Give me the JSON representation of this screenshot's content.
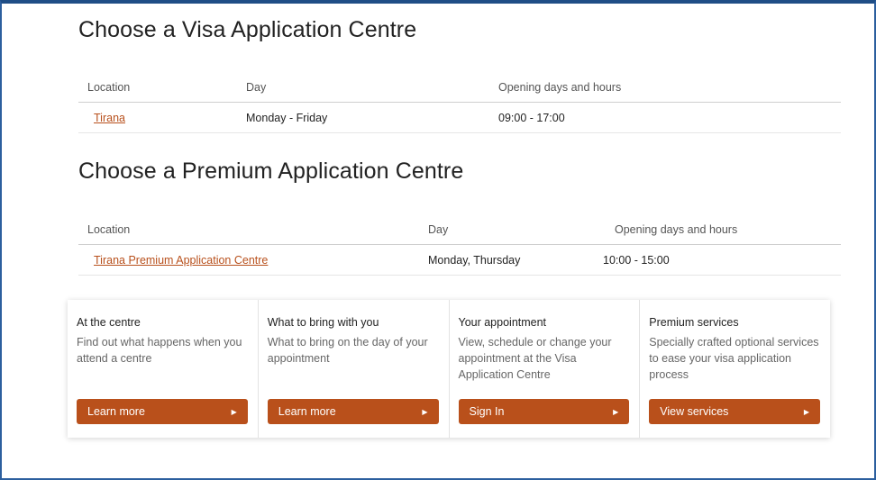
{
  "visa_section": {
    "title": "Choose a Visa Application Centre",
    "headers": [
      "Location",
      "Day",
      "Opening days and hours"
    ],
    "rows": [
      {
        "location": "Tirana",
        "day": "Monday - Friday",
        "hours": "09:00 - 17:00"
      }
    ]
  },
  "premium_section": {
    "title": "Choose a Premium Application Centre",
    "headers": [
      "Location",
      "Day",
      "Opening days and hours"
    ],
    "rows": [
      {
        "location": "Tirana Premium Application Centre",
        "day": "Monday, Thursday",
        "hours": "10:00 - 15:00"
      }
    ]
  },
  "cards": [
    {
      "title": "At the centre",
      "description": "Find out what happens when you attend a centre",
      "button": "Learn more"
    },
    {
      "title": "What to bring with you",
      "description": "What to bring on the day of your appointment",
      "button": "Learn more"
    },
    {
      "title": "Your appointment",
      "description": "View, schedule or change your appointment at the Visa Application Centre",
      "button": "Sign In"
    },
    {
      "title": "Premium services",
      "description": "Specially crafted optional services to ease your visa application process",
      "button": "View services"
    }
  ],
  "colors": {
    "accent": "#b9501b",
    "link": "#b8501c",
    "frame": "#2c5f9e"
  },
  "icons": {
    "button_arrow": "arrow-right-icon"
  }
}
